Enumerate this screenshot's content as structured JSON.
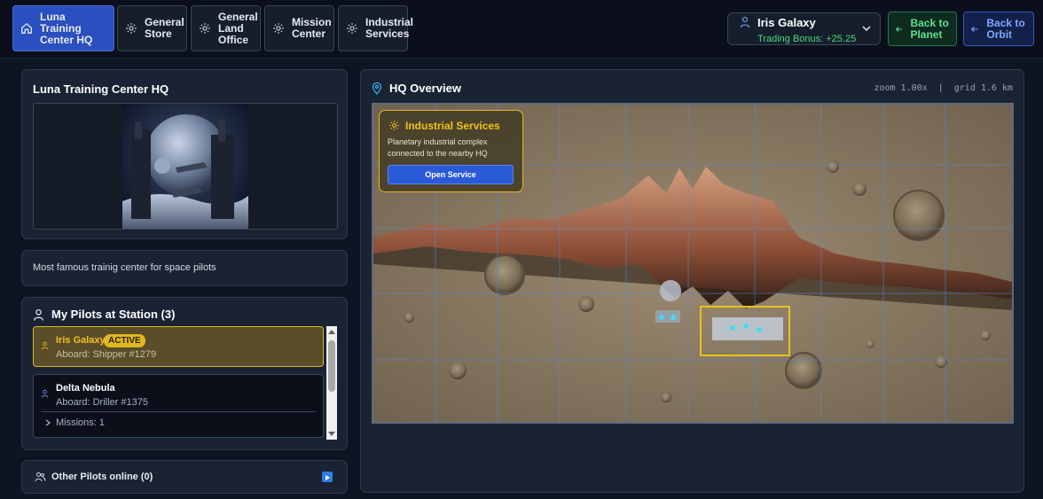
{
  "nav": {
    "tabs": [
      {
        "label": "Luna Training Center HQ",
        "icon": "home-icon",
        "active": true
      },
      {
        "label": "General Store",
        "icon": "gear-icon",
        "active": false
      },
      {
        "label": "General Land Office",
        "icon": "gear-icon",
        "active": false
      },
      {
        "label": "Mission Center",
        "icon": "gear-icon",
        "active": false
      },
      {
        "label": "Industrial Services",
        "icon": "gear-icon",
        "active": false
      }
    ]
  },
  "pilot_selector": {
    "name": "Iris Galaxy",
    "bonus": "Trading Bonus: +25.25"
  },
  "actions": {
    "back_to_planet": "Back to Planet",
    "back_to_orbit": "Back to Orbit"
  },
  "hq": {
    "title": "Luna Training Center HQ",
    "description": "Most famous trainig center for space pilots"
  },
  "pilots": {
    "title": "My Pilots at Station (3)",
    "items": [
      {
        "name": "Iris Galaxy",
        "badge": "ACTIVE",
        "aboard": "Aboard: Shipper #1279"
      },
      {
        "name": "Delta Nebula",
        "aboard": "Aboard: Driller #1375",
        "missions": "Missions: 1"
      }
    ]
  },
  "other_pilots": {
    "label": "Other Pilots online (0)"
  },
  "map": {
    "title": "HQ Overview",
    "meta": "zoom 1.00x  |  grid 1.6 km",
    "popup": {
      "title": "Industrial Services",
      "description": "Planetary industrial complex connected to the nearby HQ",
      "button": "Open Service"
    }
  },
  "colors": {
    "accent_blue": "#2a4fbe",
    "highlight_yellow": "#e0b820",
    "success_green": "#4cd87a"
  }
}
